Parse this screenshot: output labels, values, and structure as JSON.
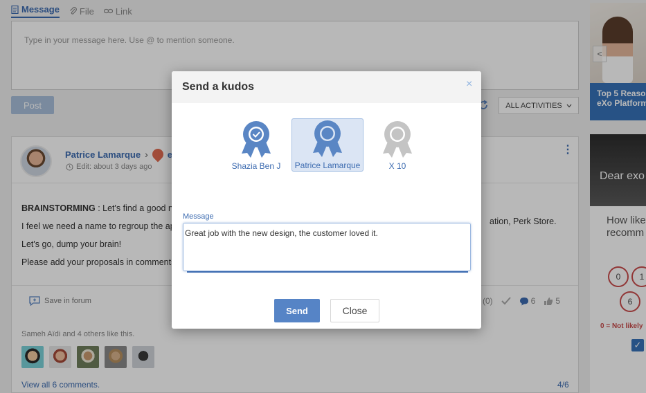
{
  "composer": {
    "tabs": [
      {
        "label": "Message",
        "icon": "document-icon"
      },
      {
        "label": "File",
        "icon": "paperclip-icon"
      },
      {
        "label": "Link",
        "icon": "link-icon"
      }
    ],
    "placeholder": "Type in your message here. Use @ to mention someone.",
    "post_label": "Post"
  },
  "filter": {
    "label": "ALL ACTIVITIES"
  },
  "activity": {
    "author": "Patrice Lamarque",
    "space_label": "eX",
    "edit_info": "Edit: about 3 days ago",
    "paragraphs": {
      "p1_bold": "BRAINSTORMING",
      "p1_rest": " : Let's find a good n",
      "p2": "I feel we need a name to regroup the ap",
      "p2_right": "ation, Perk Store.",
      "p3": "Let's go, dump your brain!",
      "p4": "Please add your proposals in comments"
    },
    "save_in_forum": "Save in forum",
    "kudos_count": "(0)",
    "comments_count": "6",
    "likes_count": "5",
    "likes_text": "Sameh Aïdi and 4 others like this.",
    "view_all": "View all 6 comments.",
    "pager": "4/6"
  },
  "sidebar": {
    "promo_caption_1": "Top 5 Reaso",
    "promo_caption_2": "eXo Platform",
    "survey_banner": "Dear exo",
    "survey_q1": "How like",
    "survey_q2": "recomm",
    "nps": [
      "0",
      "1",
      "6"
    ],
    "nps_legend": "0 = Not likely"
  },
  "modal": {
    "title": "Send a kudos",
    "recipients": [
      {
        "label": "Shazia Ben J",
        "state": "checked"
      },
      {
        "label": "Patrice Lamarque",
        "state": "selected"
      },
      {
        "label": "X 10",
        "state": "more"
      }
    ],
    "message_label": "Message",
    "message_value": "Great job with the new design, the customer loved it.",
    "send_label": "Send",
    "close_label": "Close"
  },
  "colors": {
    "accent": "#3c6bb0",
    "badge_blue": "#5a86c4",
    "badge_gray": "#c4c4c4",
    "send_button": "#5684c6"
  }
}
